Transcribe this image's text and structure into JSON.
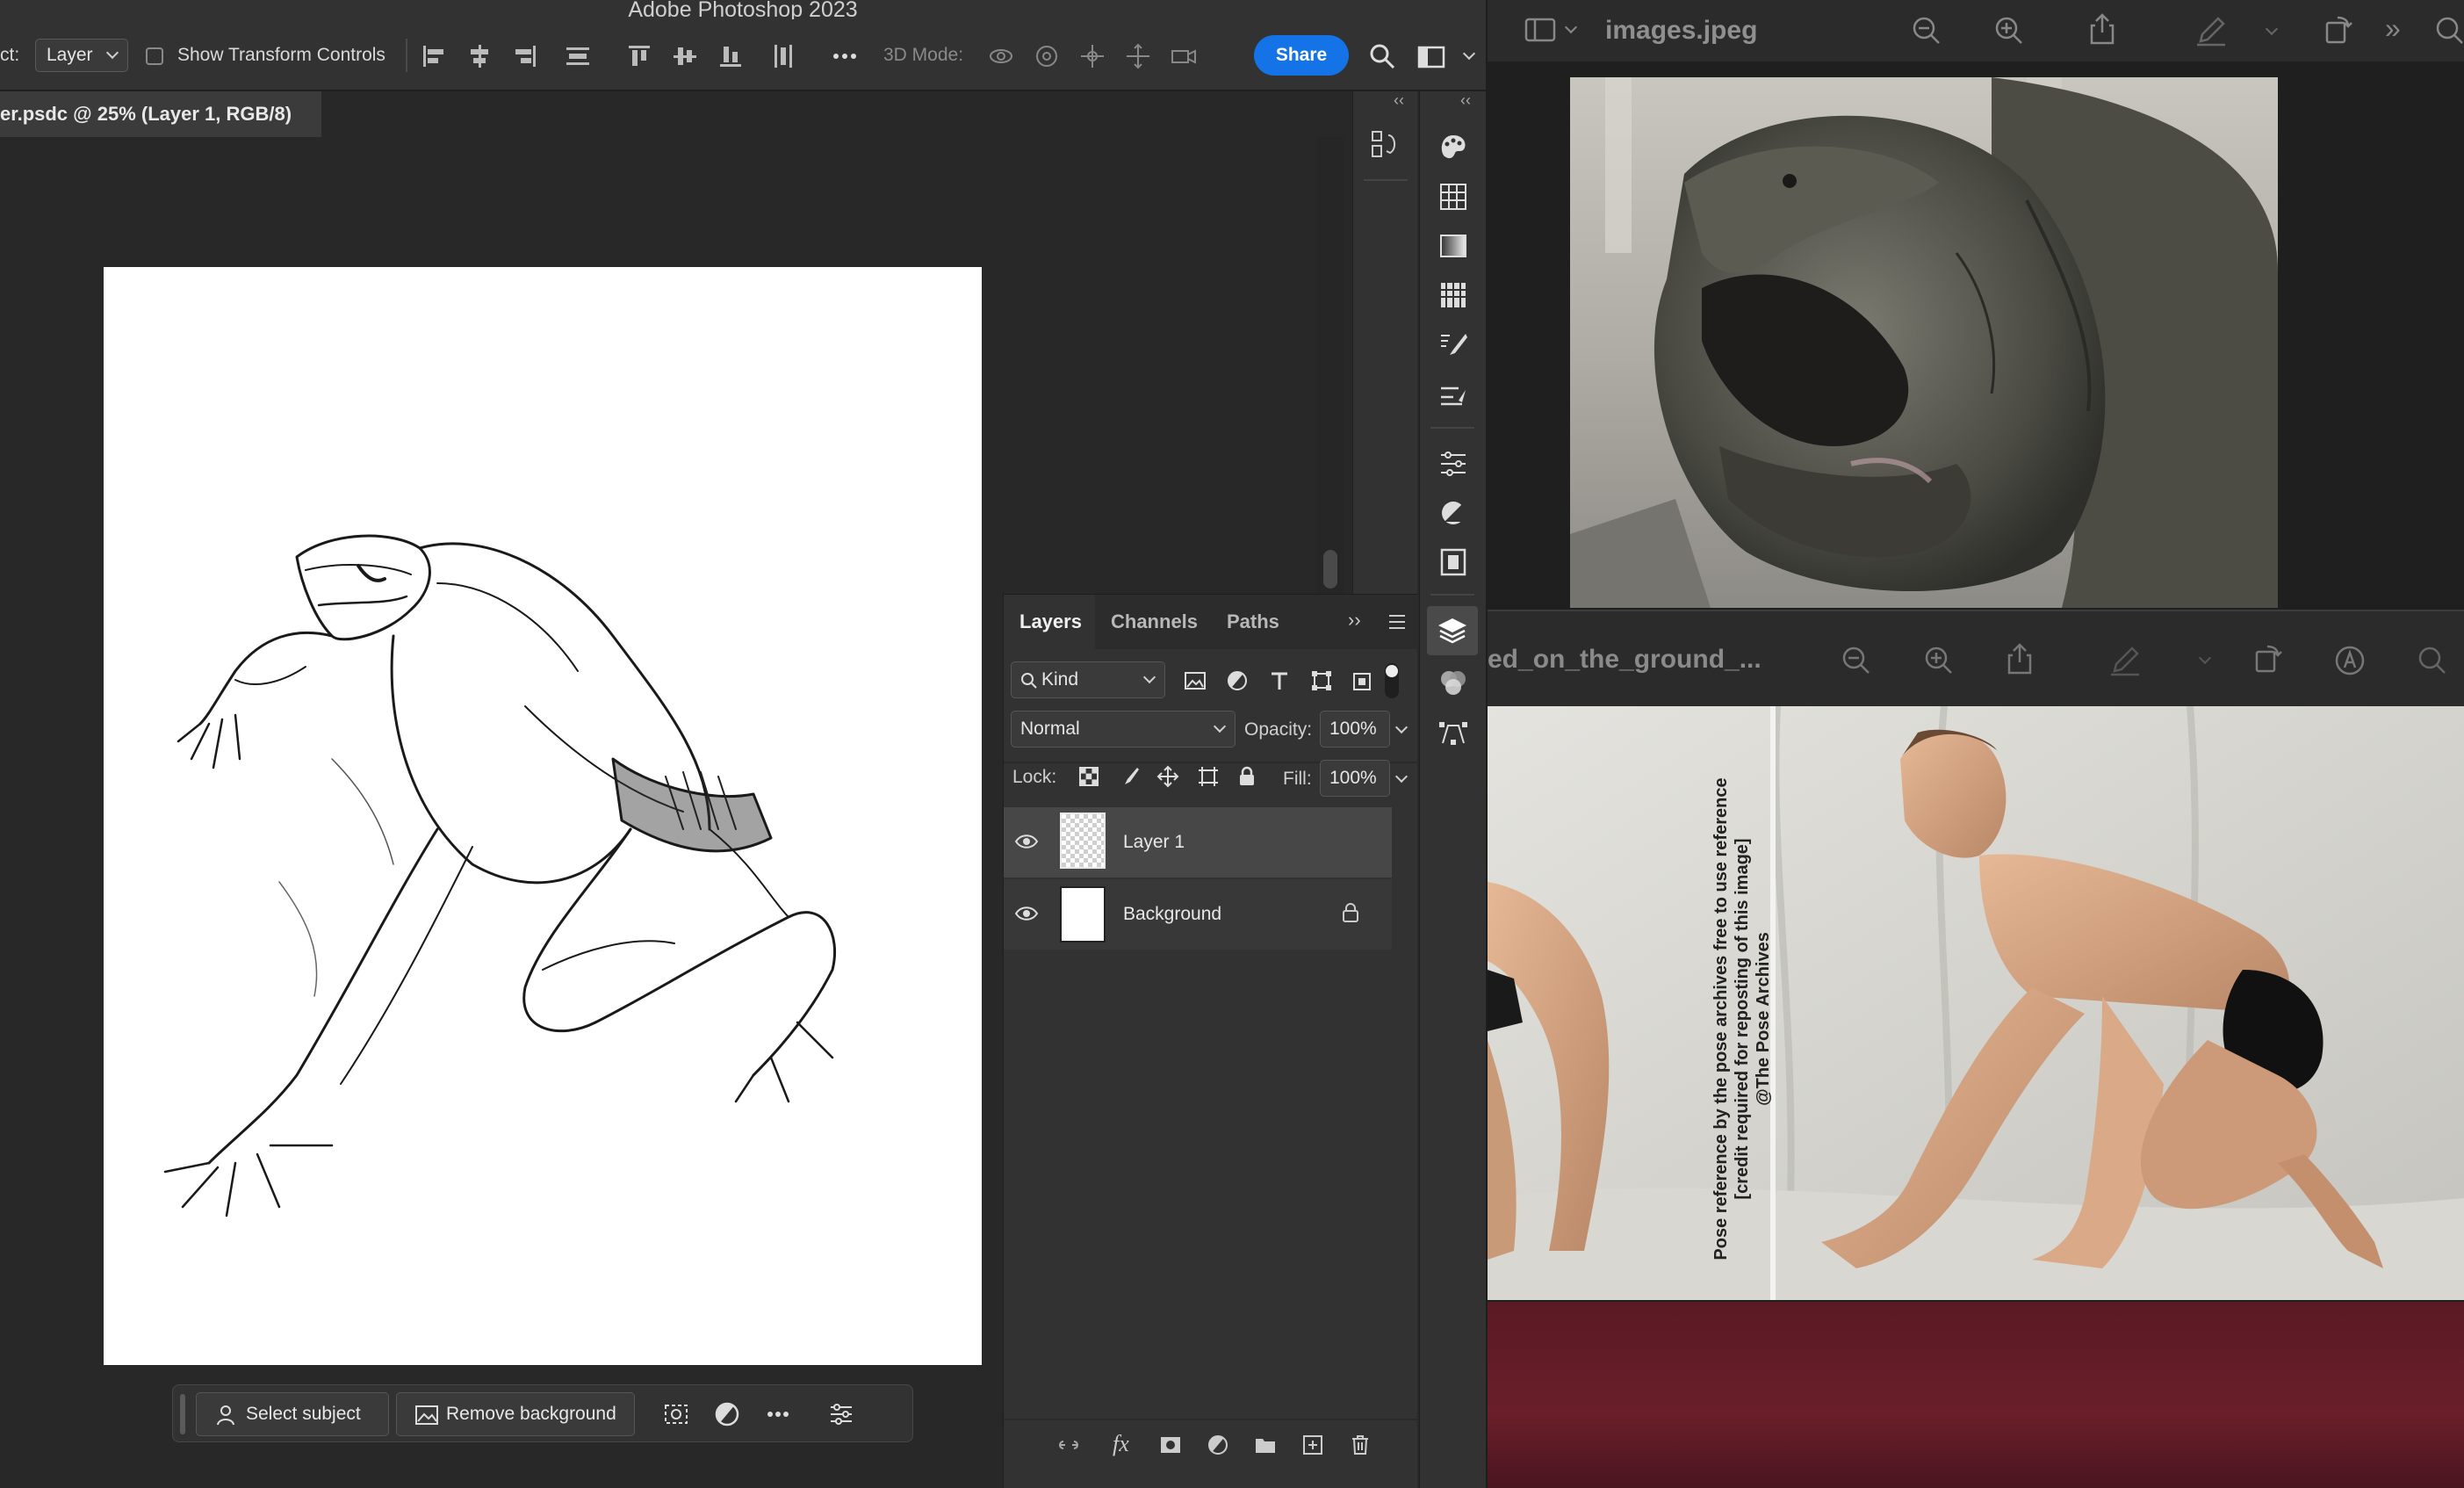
{
  "photoshop": {
    "title": "Adobe Photoshop 2023",
    "options_bar": {
      "select_label": "ct:",
      "select_value": "Layer",
      "transform_controls_label": "Show Transform Controls",
      "mode_3d_label": "3D Mode:",
      "share_label": "Share"
    },
    "document_tab": "er.psdc @ 25% (Layer 1, RGB/8)",
    "contextual_bar": {
      "select_subject": "Select subject",
      "remove_background": "Remove background"
    },
    "layers_panel": {
      "tabs": [
        "Layers",
        "Channels",
        "Paths"
      ],
      "filter_kind": "Kind",
      "blend_mode": "Normal",
      "opacity_label": "Opacity:",
      "opacity_value": "100%",
      "lock_label": "Lock:",
      "fill_label": "Fill:",
      "fill_value": "100%",
      "layers": [
        {
          "name": "Layer 1",
          "selected": true,
          "locked": false
        },
        {
          "name": "Background",
          "selected": false,
          "locked": true
        }
      ]
    }
  },
  "preview": {
    "top_window_title": "images.jpeg",
    "bottom_window_title": "ed_on_the_ground_...",
    "watermark_line1": "Pose reference by the pose archives free to use reference",
    "watermark_line2": "[credit required for reposting of this image]",
    "watermark_line3": "@The Pose Archives"
  },
  "colors": {
    "accent": "#1473e6",
    "panel_bg": "#323232",
    "canvas_bg": "#282828",
    "preview_red": "#5a1a24"
  }
}
